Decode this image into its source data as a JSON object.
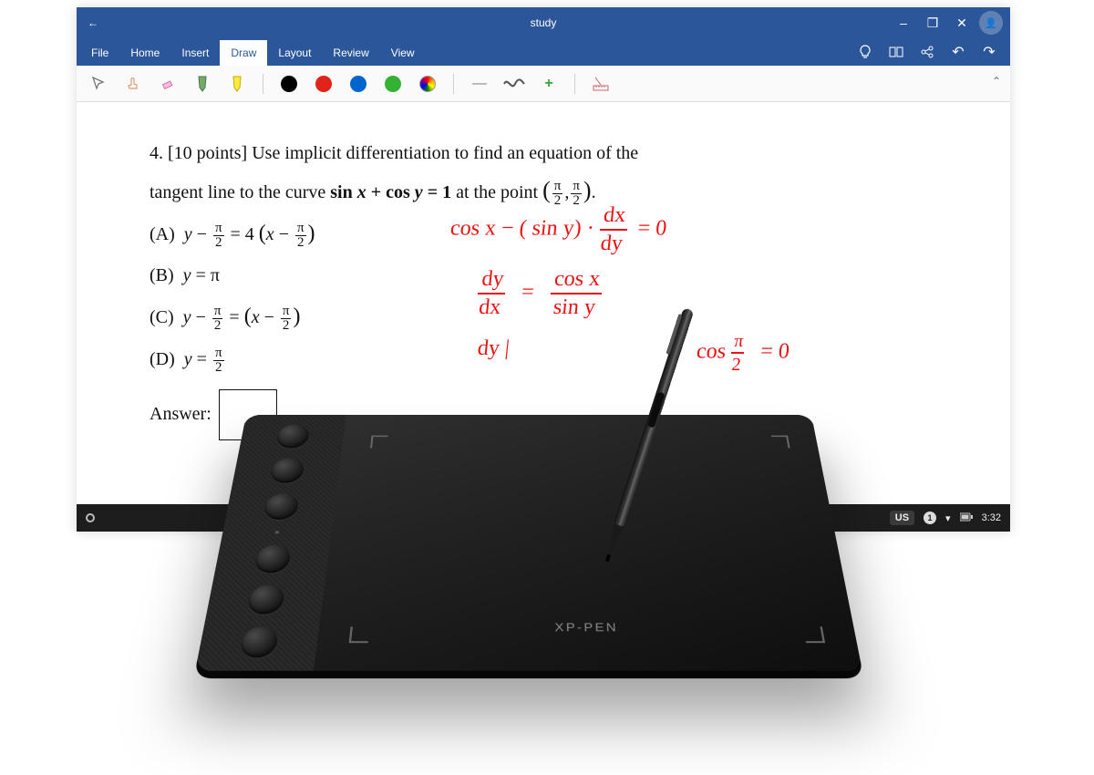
{
  "window": {
    "title": "study",
    "back_icon": "←"
  },
  "window_controls": {
    "minimize": "–",
    "maximize": "❐",
    "close": "✕"
  },
  "menu": {
    "tabs": [
      "File",
      "Home",
      "Insert",
      "Draw",
      "Layout",
      "Review",
      "View"
    ],
    "active_index": 3
  },
  "ribbon_right": {
    "idea": "💡",
    "reading": "▭",
    "share": "∝",
    "undo": "↶",
    "redo": "↷"
  },
  "draw_tools": {
    "cursor": "cursor",
    "lasso": "lasso",
    "eraser": "eraser",
    "highlighter1": "marker",
    "highlighter2": "marker-yellow",
    "colors": [
      "#000000",
      "#e2231a",
      "#0066cc",
      "#33b233",
      "#ffffff-rainbow"
    ],
    "thin": "thin-line",
    "wavy": "wavy-line",
    "add": "+",
    "ruler": "ruler"
  },
  "document": {
    "problem_number": "4.",
    "points": "[10 points]",
    "prompt_1": "Use implicit differentiation to find an equation of the",
    "prompt_2_pre": "tangent line to the curve ",
    "equation_bold": "sin x + cos y = 1",
    "prompt_2_mid": " at the point ",
    "point_num1": "π",
    "point_den1": "2",
    "point_num2": "π",
    "point_den2": "2",
    "choices": {
      "A_label": "(A)",
      "B_label": "(B)",
      "B_text": "y = π",
      "C_label": "(C)",
      "D_label": "(D)"
    },
    "answer_label": "Answer:"
  },
  "handwriting": {
    "line1": "cos x − ( sin y) ·",
    "line1_frac_num": "dx",
    "line1_frac_den": "dy",
    "line1_eq": "= 0",
    "line2_left_num": "dy",
    "line2_left_den": "dx",
    "line2_eq": "=",
    "line2_right_num": "cos x",
    "line2_right_den": "sin y",
    "line3_left": "dy |",
    "line3_cos": "cos",
    "line3_frac_num": "π",
    "line3_frac_den": "2",
    "line3_eq": "= 0",
    "stray": ")"
  },
  "taskbar": {
    "locale": "US",
    "status_number": "1",
    "down": "▾",
    "battery": "🔋",
    "time": "3:32"
  },
  "tablet": {
    "brand": "XP-PEN",
    "button_count": 6
  }
}
